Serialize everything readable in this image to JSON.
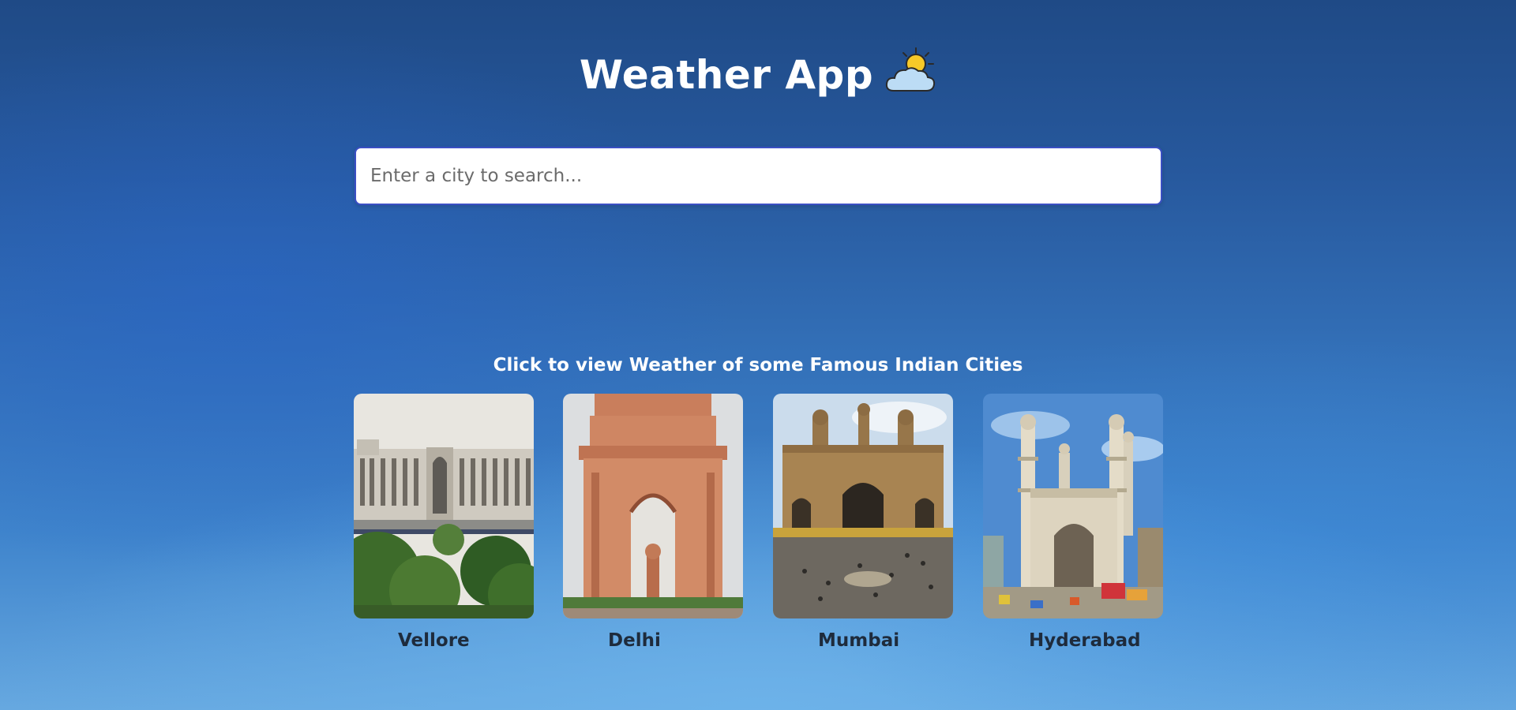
{
  "app": {
    "title": "Weather App",
    "title_icon": "sun-behind-cloud-icon"
  },
  "search": {
    "placeholder": "Enter a city to search...",
    "value": ""
  },
  "featured": {
    "heading": "Click to view Weather of some Famous Indian Cities",
    "cities": [
      {
        "name": "Vellore",
        "image": "vellore-building-photo"
      },
      {
        "name": "Delhi",
        "image": "india-gate-photo"
      },
      {
        "name": "Mumbai",
        "image": "gateway-of-india-photo"
      },
      {
        "name": "Hyderabad",
        "image": "charminar-photo"
      }
    ]
  },
  "colors": {
    "background_top": "#1f4a86",
    "background_bottom": "#66a8e0",
    "search_border": "#3b4fc4",
    "city_label": "#1e2b3c"
  }
}
